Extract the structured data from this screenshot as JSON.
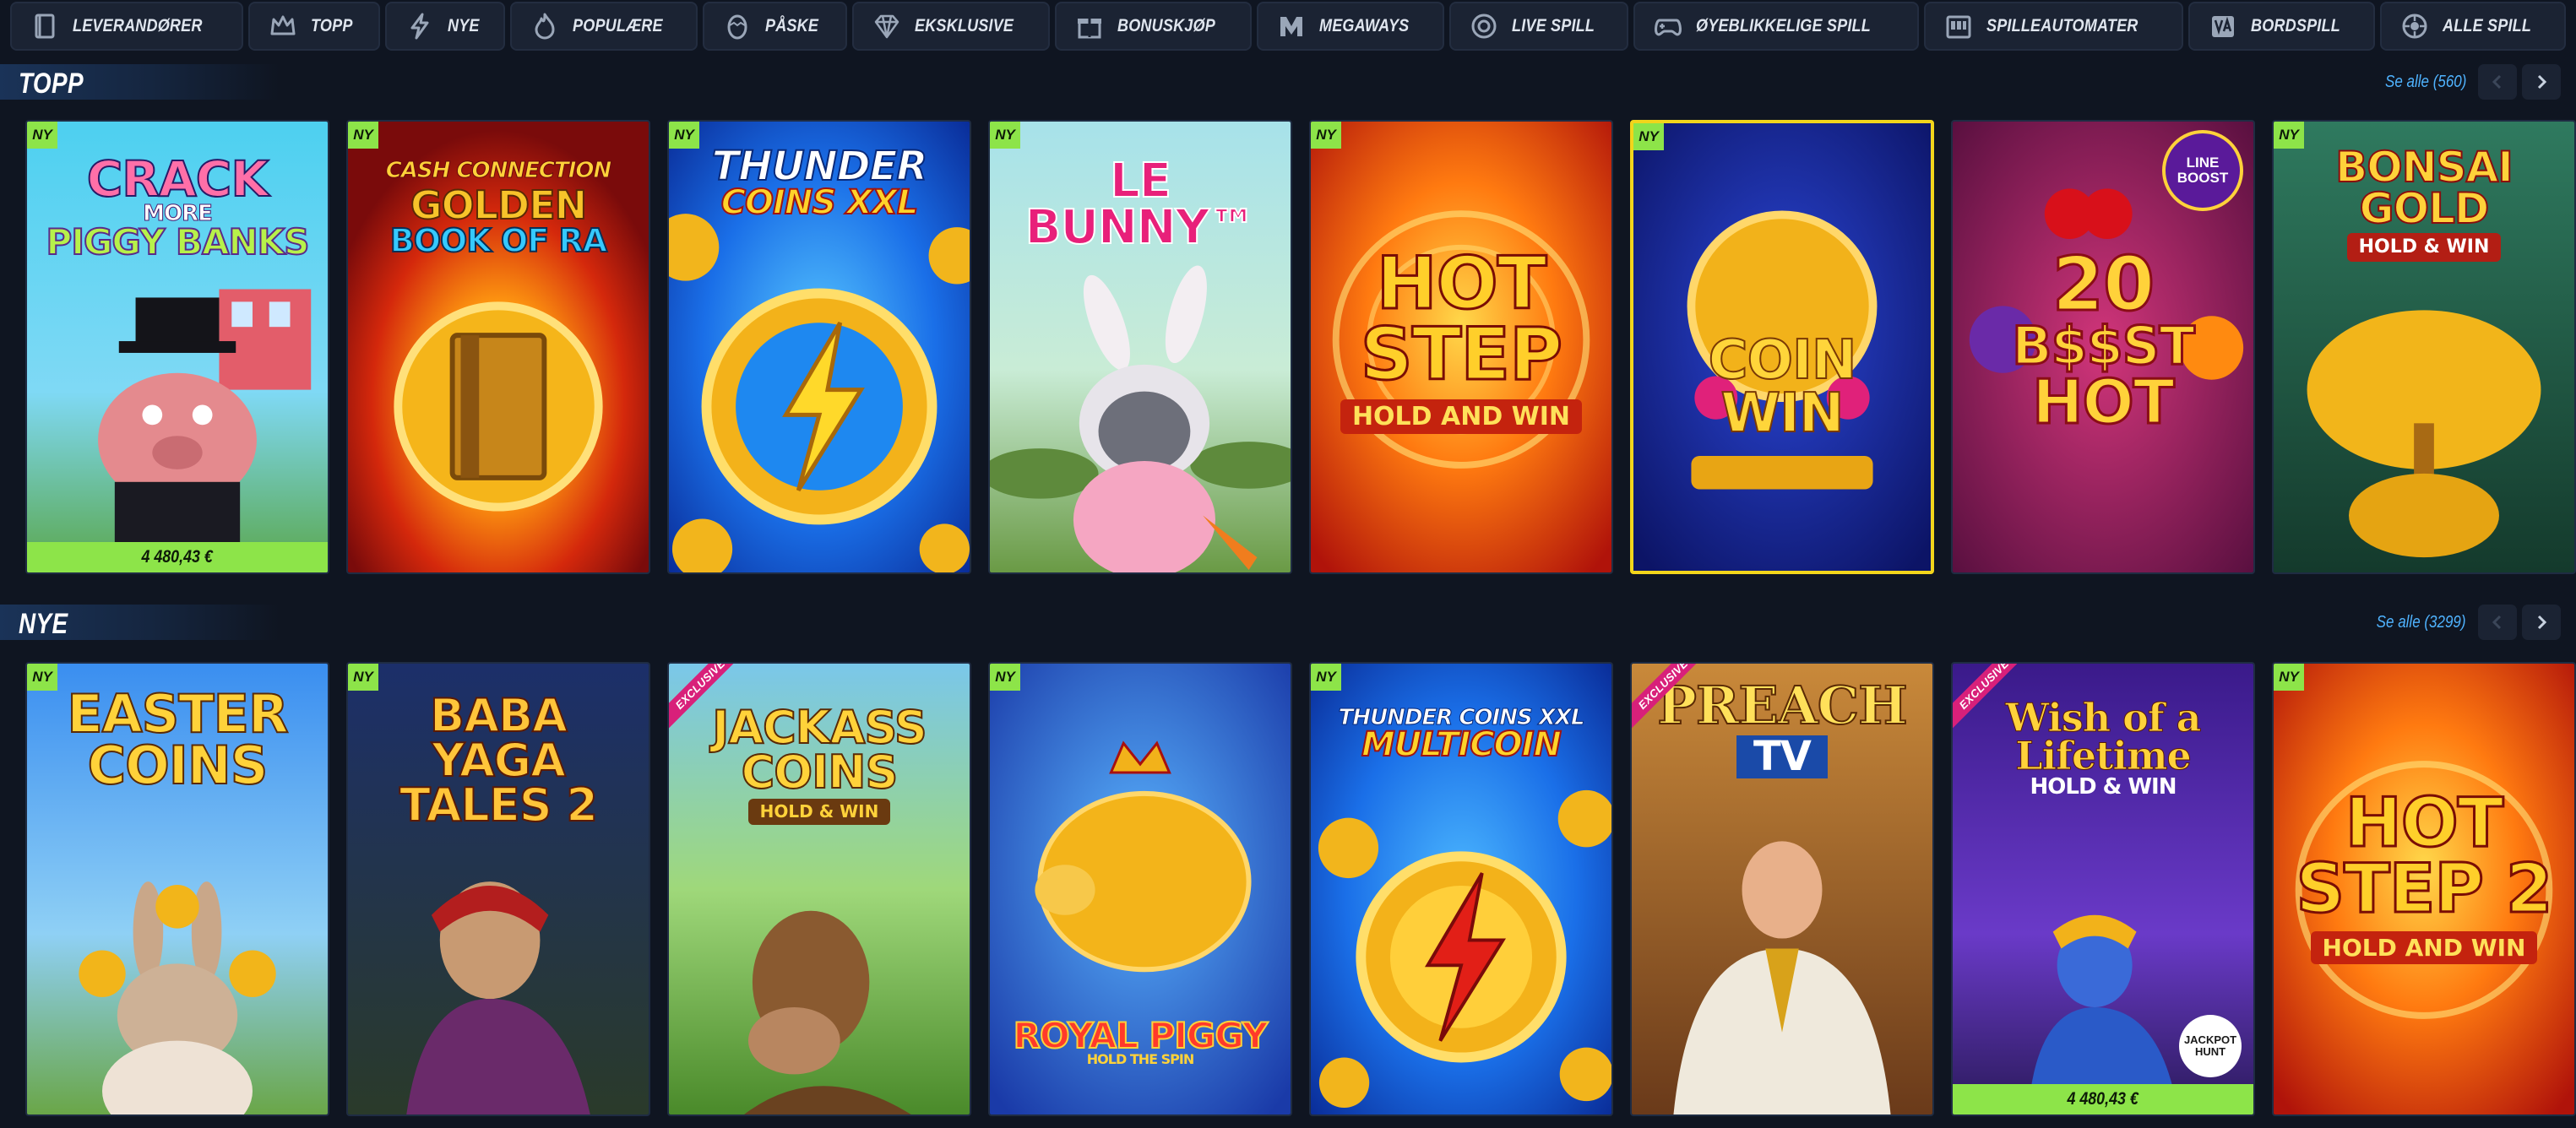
{
  "nav": [
    {
      "label": "LEVERANDØRER",
      "icon": "book-icon"
    },
    {
      "label": "TOPP",
      "icon": "crown-icon"
    },
    {
      "label": "NYE",
      "icon": "lightning-icon"
    },
    {
      "label": "POPULÆRE",
      "icon": "flame-icon"
    },
    {
      "label": "PÅSKE",
      "icon": "easter-egg-icon"
    },
    {
      "label": "EKSKLUSIVE",
      "icon": "diamond-icon"
    },
    {
      "label": "BONUSKJØP",
      "icon": "gift-icon"
    },
    {
      "label": "MEGAWAYS",
      "icon": "megaways-m-icon"
    },
    {
      "label": "LIVE SPILL",
      "icon": "roulette-chip-icon"
    },
    {
      "label": "ØYEBLIKKELIGE SPILL",
      "icon": "gamepad-icon"
    },
    {
      "label": "SPILLEAUTOMATER",
      "icon": "slot-machine-icon"
    },
    {
      "label": "BORDSPILL",
      "icon": "playing-card-icon"
    },
    {
      "label": "ALLE SPILL",
      "icon": "globe-icon"
    }
  ],
  "sections": [
    {
      "title": "TOPP",
      "see_all": "Se alle (560)",
      "games": [
        {
          "name": "Crack More Piggy Banks",
          "title_lines": [
            "CRACK",
            "MORE",
            "PIGGY BANKS"
          ],
          "badge": "NY",
          "jackpot": "4 480,43 €"
        },
        {
          "name": "Cash Connection Golden Book of Ra",
          "title_lines": [
            "CASH CONNECTION",
            "GOLDEN",
            "BOOK OF RA"
          ],
          "badge": "NY"
        },
        {
          "name": "Thunder Coins XXL",
          "title_lines": [
            "THUNDER",
            "COINS XXL"
          ],
          "badge": "NY"
        },
        {
          "name": "Le Bunny",
          "title_lines": [
            "LE",
            "BUNNY™"
          ],
          "badge": "NY"
        },
        {
          "name": "Hot Step Hold and Win",
          "title_lines": [
            "HOT",
            "STEP"
          ],
          "subtitle": "HOLD AND WIN",
          "badge": "NY"
        },
        {
          "name": "Coin Win",
          "title_lines": [
            "COIN",
            "WIN"
          ],
          "badge": "NY"
        },
        {
          "name": "20 Boost Hot",
          "title_lines": [
            "20",
            "B$$ST",
            "HOT"
          ],
          "corner": "LINE BOOST"
        },
        {
          "name": "Bonsai Gold Hold & Win",
          "title_lines": [
            "BONSAI",
            "GOLD"
          ],
          "subtitle": "HOLD & WIN",
          "badge": "NY"
        }
      ]
    },
    {
      "title": "NYE",
      "see_all": "Se alle (3299)",
      "games": [
        {
          "name": "Easter Coins",
          "title_lines": [
            "EASTER",
            "COINS"
          ],
          "badge": "NY"
        },
        {
          "name": "Baba Yaga Tales 2",
          "title_lines": [
            "BABA YAGA",
            "TALES 2"
          ],
          "badge": "NY"
        },
        {
          "name": "Jackass Coins Hold & Win",
          "title_lines": [
            "JACKASS",
            "COINS"
          ],
          "subtitle": "HOLD & WIN",
          "ribbon": "EXCLUSIVE"
        },
        {
          "name": "Royal Piggy Hold the Spin",
          "title_lines": [
            "ROYAL PIGGY"
          ],
          "subtitle": "HOLD THE SPIN",
          "badge": "NY"
        },
        {
          "name": "Thunder Coins XXL Multicoin",
          "title_lines": [
            "THUNDER COINS XXL",
            "MULTICOIN"
          ],
          "badge": "NY"
        },
        {
          "name": "Preach TV",
          "title_lines": [
            "PREACH",
            "TV"
          ],
          "ribbon": "EXCLUSIVE"
        },
        {
          "name": "Wish of a Lifetime Hold & Win",
          "title_lines": [
            "Wish of a",
            "Lifetime"
          ],
          "subtitle": "HOLD & WIN",
          "ribbon": "EXCLUSIVE",
          "jackpot": "4 480,43 €",
          "corner": "JACKPOT HUNT"
        },
        {
          "name": "Hot Step 2 Hold and Win",
          "title_lines": [
            "HOT",
            "STEP 2"
          ],
          "subtitle": "HOLD AND WIN",
          "badge": "NY"
        }
      ]
    }
  ],
  "colors": {
    "background": "#0f1521",
    "nav_bg": "#1b2333",
    "new_badge": "#8de449",
    "exclusive_ribbon": "#d8207a",
    "see_all_link": "#4fb3ff",
    "highlight_border": "#f2d51b"
  }
}
